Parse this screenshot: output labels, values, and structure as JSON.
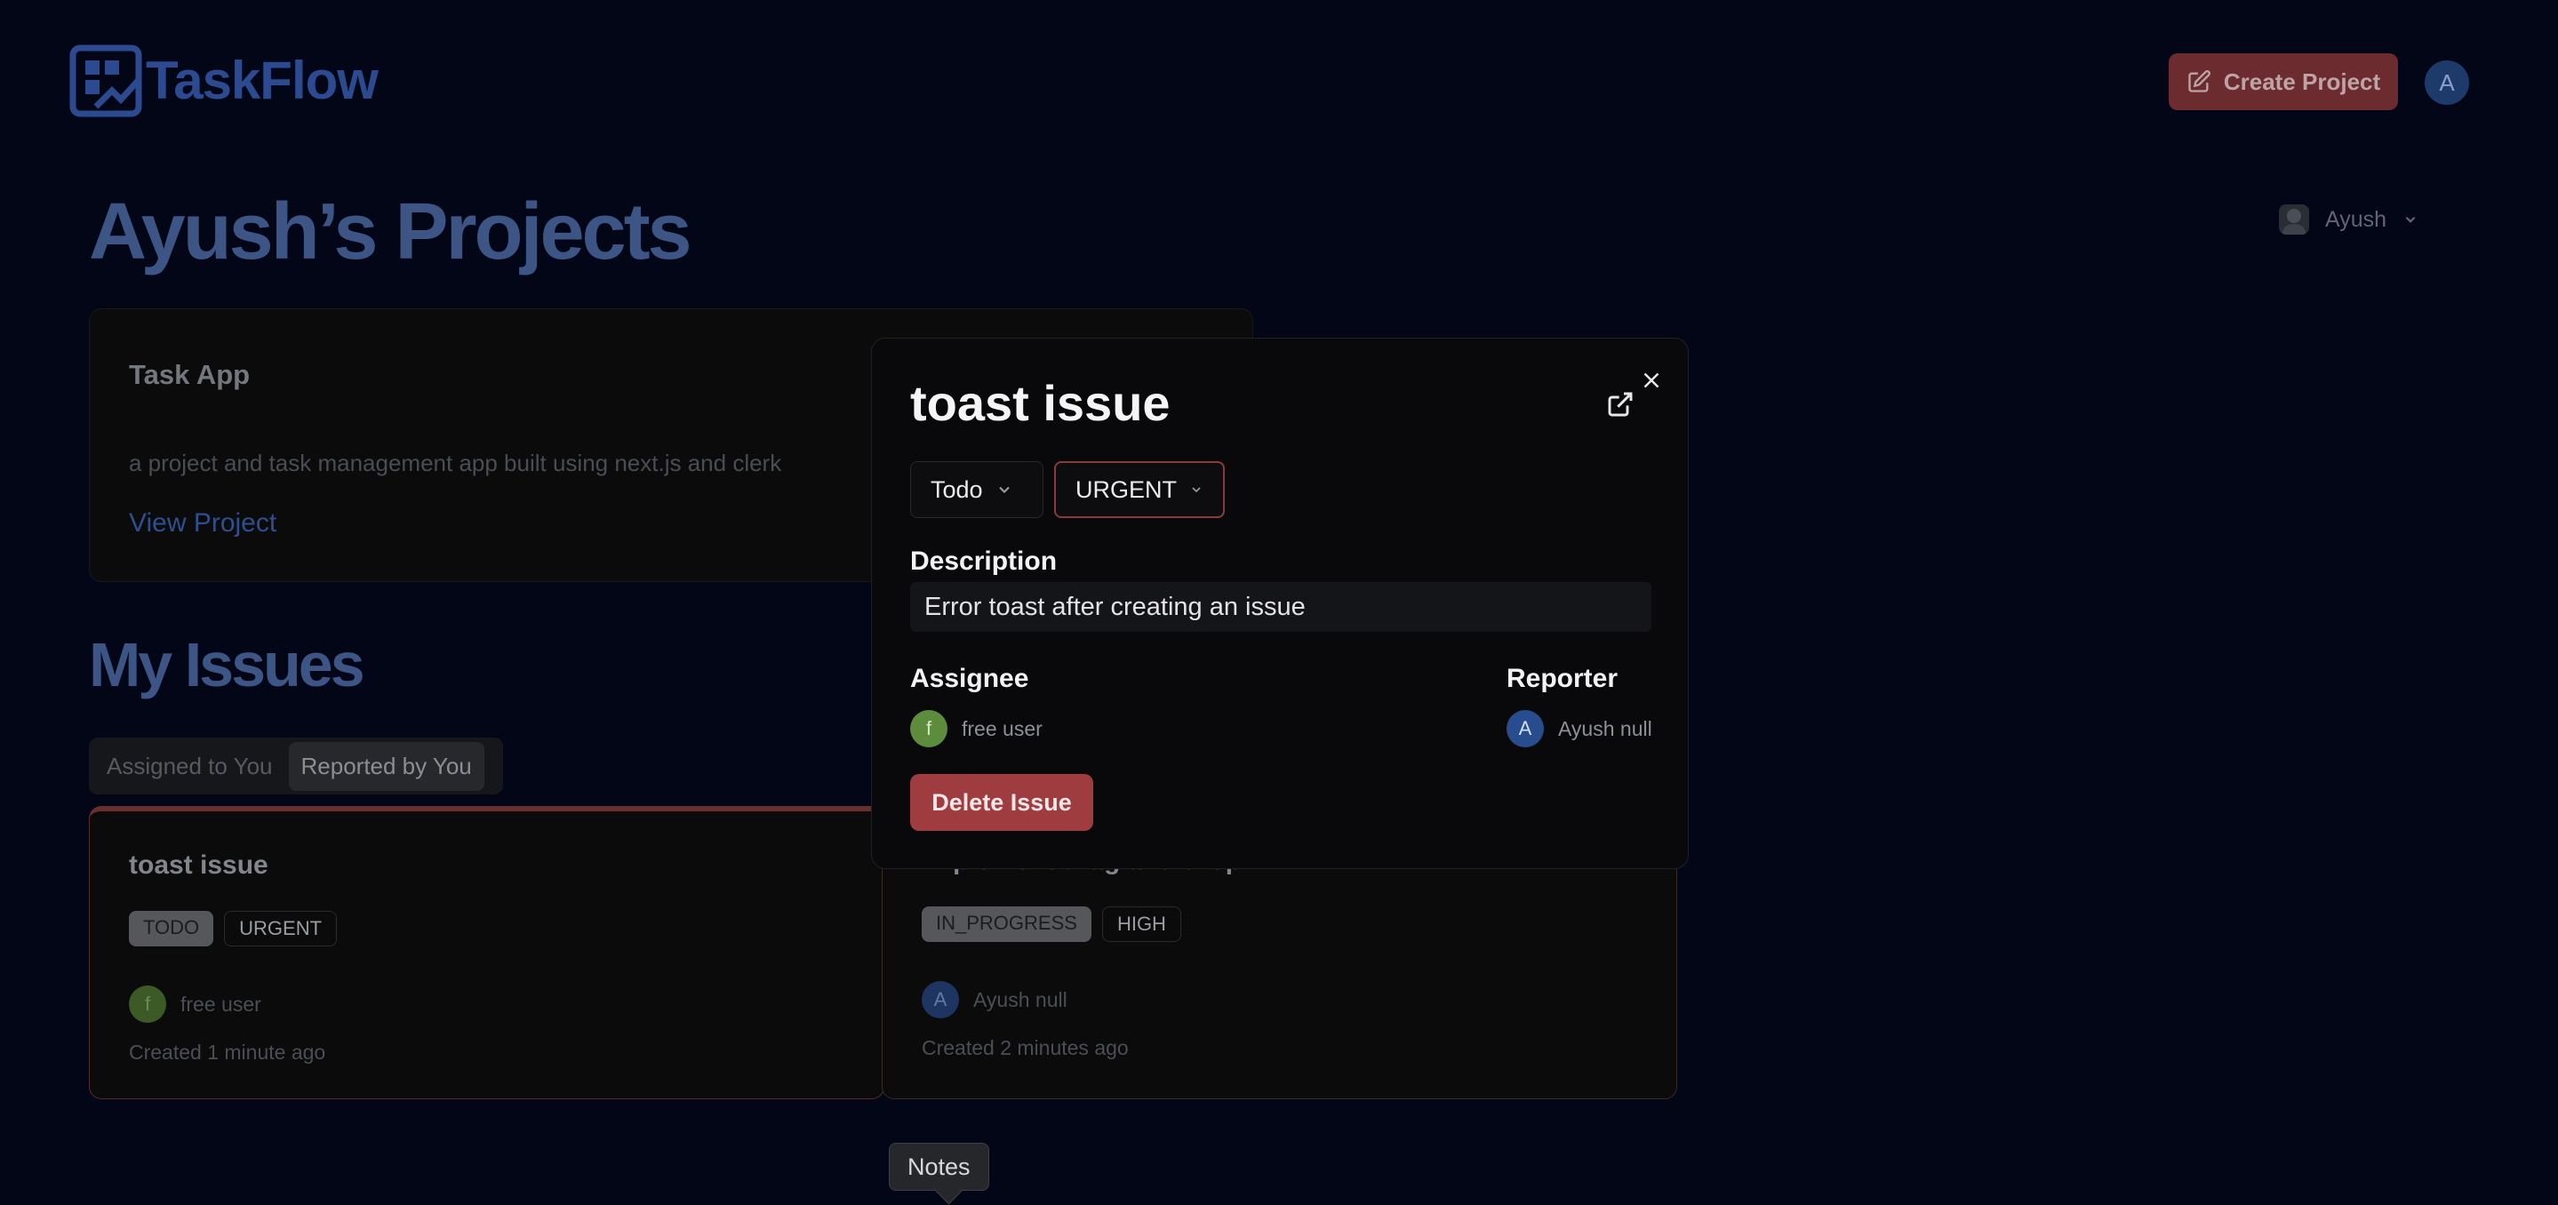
{
  "header": {
    "brand": "TaskFlow",
    "create_project_label": "Create Project",
    "user_initial": "A"
  },
  "page": {
    "title": "Ayush’s Projects",
    "org_name": "Ayush"
  },
  "project": {
    "name": "Task App",
    "description": "a project and task management app built using next.js and clerk",
    "link_label": "View Project"
  },
  "issues": {
    "title": "My Issues",
    "tabs": [
      "Assigned to You",
      "Reported by You"
    ],
    "active_tab": "Reported by You",
    "cards": [
      {
        "title": "toast issue",
        "status": "TODO",
        "priority": "URGENT",
        "user_initial": "f",
        "user_name": "free user",
        "created": "Created 1 minute ago"
      },
      {
        "title": "Implement drag and drop",
        "status": "IN_PROGRESS",
        "priority": "HIGH",
        "user_initial": "A",
        "user_name": "Ayush null",
        "created": "Created 2 minutes ago"
      }
    ]
  },
  "tooltip": {
    "label": "Notes"
  },
  "modal": {
    "title": "toast issue",
    "status_value": "Todo",
    "priority_value": "URGENT",
    "description_label": "Description",
    "description": "Error toast after creating an issue",
    "assignee_label": "Assignee",
    "assignee_initial": "f",
    "assignee_name": "free user",
    "reporter_label": "Reporter",
    "reporter_initial": "A",
    "reporter_name": "Ayush null",
    "delete_label": "Delete Issue"
  },
  "colors": {
    "background": "#020617",
    "brand": "#2b4a8f",
    "danger": "#9f3c40",
    "assignee_avatar": "#5d8c3d",
    "reporter_avatar": "#284d8f"
  }
}
